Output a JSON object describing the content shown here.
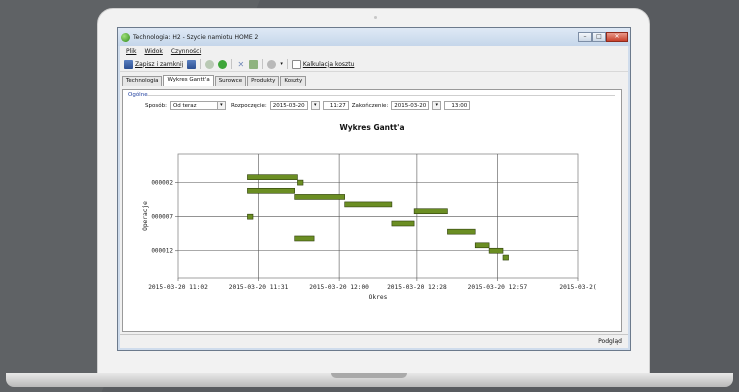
{
  "window": {
    "title": "Technologia: H2 - Szycie namiotu HOME 2"
  },
  "menu": [
    "Plik",
    "Widok",
    "Czynności"
  ],
  "toolbar": {
    "save_close": "Zapisz i zamknij",
    "cost_calc": "Kalkulacja kosztu"
  },
  "tabs": [
    {
      "label": "Technologia",
      "active": false
    },
    {
      "label": "Wykres Gantt'a",
      "active": true
    },
    {
      "label": "Surowce",
      "active": false
    },
    {
      "label": "Produkty",
      "active": false
    },
    {
      "label": "Koszty",
      "active": false
    }
  ],
  "form": {
    "group": "Ogólne",
    "method_label": "Sposób:",
    "method_value": "Od teraz",
    "start_label": "Rozpoczęcie:",
    "start_date": "2015-03-20",
    "start_time": "11:27",
    "end_label": "Zakończenie:",
    "end_date": "2015-03-20",
    "end_time": "13:00"
  },
  "status": {
    "text": "Podgląd"
  },
  "chart_data": {
    "type": "gantt",
    "title": "Wykres Gantt'a",
    "xlabel": "Okres",
    "ylabel": "Operacje",
    "x_ticks": [
      "2015-03-20 11:02",
      "2015-03-20 11:31",
      "2015-03-20 12:00",
      "2015-03-20 12:28",
      "2015-03-20 12:57",
      "2015-03-2("
    ],
    "x_tick_minutes": [
      0,
      29,
      58,
      86,
      115,
      144
    ],
    "xlim_minutes": [
      0,
      144
    ],
    "y_ticks": [
      "000002",
      "000007",
      "000012"
    ],
    "y_tick_rows": [
      2,
      7,
      12
    ],
    "ylim_rows": [
      -2.2,
      16
    ],
    "bar_color": "#6b8e23",
    "grid": true,
    "tasks": [
      {
        "row": 1.2,
        "start": 25,
        "end": 43
      },
      {
        "row": 2.0,
        "start": 43,
        "end": 45
      },
      {
        "row": 3.2,
        "start": 25,
        "end": 42
      },
      {
        "row": 4.1,
        "start": 42,
        "end": 60
      },
      {
        "row": 5.2,
        "start": 60,
        "end": 77
      },
      {
        "row": 6.2,
        "start": 85,
        "end": 97
      },
      {
        "row": 7.0,
        "start": 25,
        "end": 27
      },
      {
        "row": 8.0,
        "start": 77,
        "end": 85
      },
      {
        "row": 9.2,
        "start": 97,
        "end": 107
      },
      {
        "row": 10.2,
        "start": 42,
        "end": 49
      },
      {
        "row": 11.2,
        "start": 107,
        "end": 112
      },
      {
        "row": 12.0,
        "start": 112,
        "end": 117
      },
      {
        "row": 13.0,
        "start": 117,
        "end": 119
      }
    ]
  }
}
